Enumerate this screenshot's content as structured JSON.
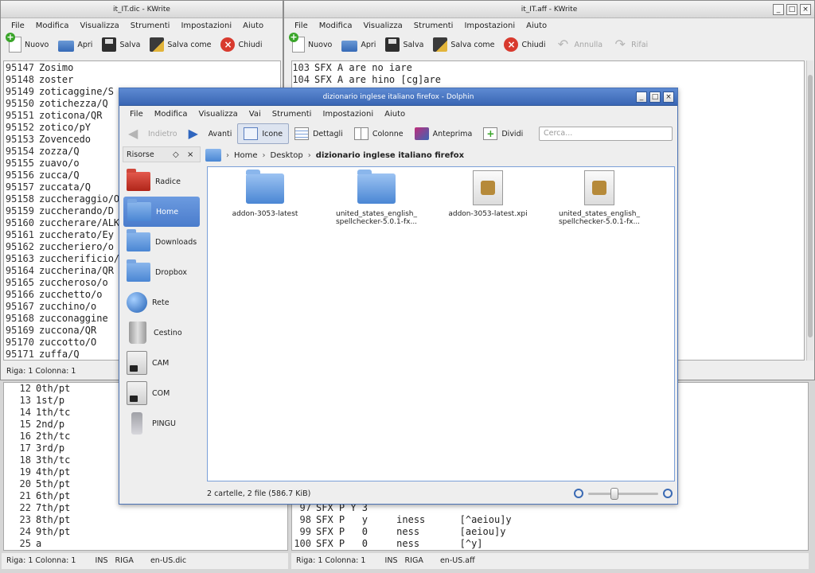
{
  "left_window": {
    "title": "it_IT.dic - KWrite",
    "menu": [
      "File",
      "Modifica",
      "Visualizza",
      "Strumenti",
      "Impostazioni",
      "Aiuto"
    ],
    "toolbar": {
      "new": "Nuovo",
      "open": "Apri",
      "save": "Salva",
      "save_as": "Salva come",
      "close": "Chiudi"
    },
    "lines": [
      {
        "n": "95147",
        "t": "Zosimo"
      },
      {
        "n": "95148",
        "t": "zoster"
      },
      {
        "n": "95149",
        "t": "zoticaggine/S"
      },
      {
        "n": "95150",
        "t": "zotichezza/Q"
      },
      {
        "n": "95151",
        "t": "zoticona/QR"
      },
      {
        "n": "95152",
        "t": "zotico/pY"
      },
      {
        "n": "95153",
        "t": "Zovencedo"
      },
      {
        "n": "95154",
        "t": "zozza/Q"
      },
      {
        "n": "95155",
        "t": "zuavo/o"
      },
      {
        "n": "95156",
        "t": "zucca/Q"
      },
      {
        "n": "95157",
        "t": "zuccata/Q"
      },
      {
        "n": "95158",
        "t": "zuccheraggio/O"
      },
      {
        "n": "95159",
        "t": "zuccherando/D"
      },
      {
        "n": "95160",
        "t": "zuccherare/ALK"
      },
      {
        "n": "95161",
        "t": "zuccherato/Ey"
      },
      {
        "n": "95162",
        "t": "zuccheriero/o"
      },
      {
        "n": "95163",
        "t": "zuccherificio/"
      },
      {
        "n": "95164",
        "t": "zuccherina/QR"
      },
      {
        "n": "95165",
        "t": "zuccheroso/o"
      },
      {
        "n": "95166",
        "t": "zucchetto/o"
      },
      {
        "n": "95167",
        "t": "zucchino/o"
      },
      {
        "n": "95168",
        "t": "zucconaggine"
      },
      {
        "n": "95169",
        "t": "zuccona/QR"
      },
      {
        "n": "95170",
        "t": "zuccotto/O"
      },
      {
        "n": "95171",
        "t": "zuffa/Q"
      }
    ],
    "status": "Riga: 1 Colonna: 1"
  },
  "right_window": {
    "title": "it_IT.aff - KWrite",
    "menu": [
      "File",
      "Modifica",
      "Visualizza",
      "Strumenti",
      "Impostazioni",
      "Aiuto"
    ],
    "toolbar": {
      "new": "Nuovo",
      "open": "Apri",
      "save": "Salva",
      "save_as": "Salva come",
      "close": "Chiudi",
      "undo": "Annulla",
      "redo": "Rifai"
    },
    "lines": [
      {
        "n": "103",
        "t": "SFX A are no iare"
      },
      {
        "n": "104",
        "t": "SFX A are hino [cg]are"
      }
    ]
  },
  "bottom_left": {
    "lines": [
      {
        "n": "12",
        "t": "0th/pt"
      },
      {
        "n": "13",
        "t": "1st/p"
      },
      {
        "n": "14",
        "t": "1th/tc"
      },
      {
        "n": "15",
        "t": "2nd/p"
      },
      {
        "n": "16",
        "t": "2th/tc"
      },
      {
        "n": "17",
        "t": "3rd/p"
      },
      {
        "n": "18",
        "t": "3th/tc"
      },
      {
        "n": "19",
        "t": "4th/pt"
      },
      {
        "n": "20",
        "t": "5th/pt"
      },
      {
        "n": "21",
        "t": "6th/pt"
      },
      {
        "n": "22",
        "t": "7th/pt"
      },
      {
        "n": "23",
        "t": "8th/pt"
      },
      {
        "n": "24",
        "t": "9th/pt"
      },
      {
        "n": "25",
        "t": "a"
      }
    ],
    "status": "Riga: 1 Colonna: 1        INS   RIGA       en-US.dic"
  },
  "bottom_right": {
    "lines": [
      {
        "n": "97",
        "t": "SFX P Y 3"
      },
      {
        "n": "98",
        "t": "SFX P   y     iness      [^aeiou]y"
      },
      {
        "n": "99",
        "t": "SFX P   0     ness       [aeiou]y"
      },
      {
        "n": "100",
        "t": "SFX P   0     ness       [^y]"
      }
    ],
    "status": "Riga: 1 Colonna: 1        INS   RIGA       en-US.aff"
  },
  "dolphin": {
    "title": "dizionario inglese italiano firefox - Dolphin",
    "menu": [
      "File",
      "Modifica",
      "Visualizza",
      "Vai",
      "Strumenti",
      "Impostazioni",
      "Aiuto"
    ],
    "toolbar": {
      "back": "Indietro",
      "forward": "Avanti",
      "icons": "Icone",
      "details": "Dettagli",
      "columns": "Colonne",
      "preview": "Anteprima",
      "split": "Dividi"
    },
    "search_placeholder": "Cerca...",
    "places_title": "Risorse",
    "places": [
      "Radice",
      "Home",
      "Downloads",
      "Dropbox",
      "Rete",
      "Cestino",
      "CAM",
      "COM",
      "PINGU"
    ],
    "breadcrumb": [
      "Home",
      "Desktop",
      "dizionario inglese italiano firefox"
    ],
    "files": [
      {
        "name": "addon-3053-latest",
        "name2": "",
        "kind": "folder"
      },
      {
        "name": "united_states_english_",
        "name2": "spellchecker-5.0.1-fx...",
        "kind": "folder"
      },
      {
        "name": "addon-3053-latest.xpi",
        "name2": "",
        "kind": "archive"
      },
      {
        "name": "united_states_english_",
        "name2": "spellchecker-5.0.1-fx...",
        "kind": "archive"
      }
    ],
    "status": "2 cartelle, 2 file (586.7 KiB)"
  }
}
